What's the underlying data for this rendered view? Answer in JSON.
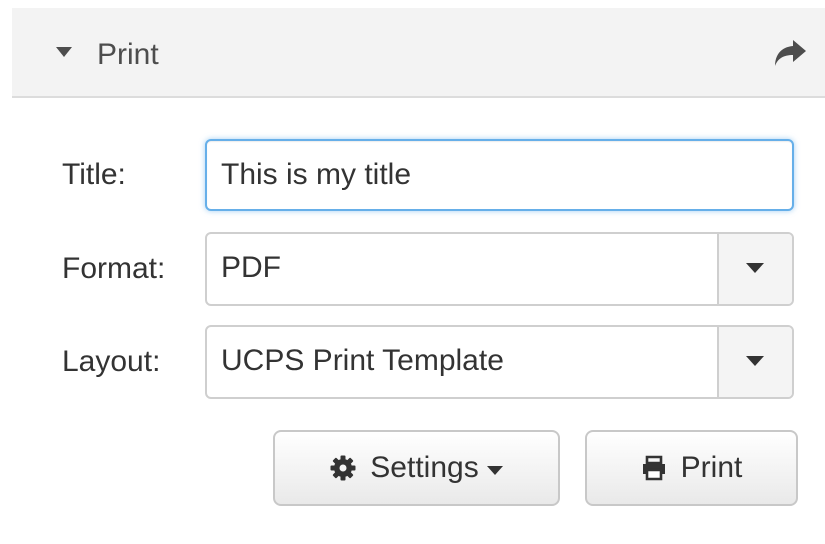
{
  "panel": {
    "title": "Print"
  },
  "icons": {
    "collapse": "caret-down-icon",
    "share": "share-arrow-icon",
    "settings": "gear-icon",
    "print": "printer-icon"
  },
  "form": {
    "title_label": "Title:",
    "title_value": "This is my title",
    "format_label": "Format:",
    "format_value": "PDF",
    "layout_label": "Layout:",
    "layout_value": "UCPS Print Template"
  },
  "buttons": {
    "settings_label": "Settings",
    "print_label": "Print"
  },
  "colors": {
    "header_bg": "#f3f3f3",
    "focus_border": "#66afe9",
    "text": "#333333"
  }
}
